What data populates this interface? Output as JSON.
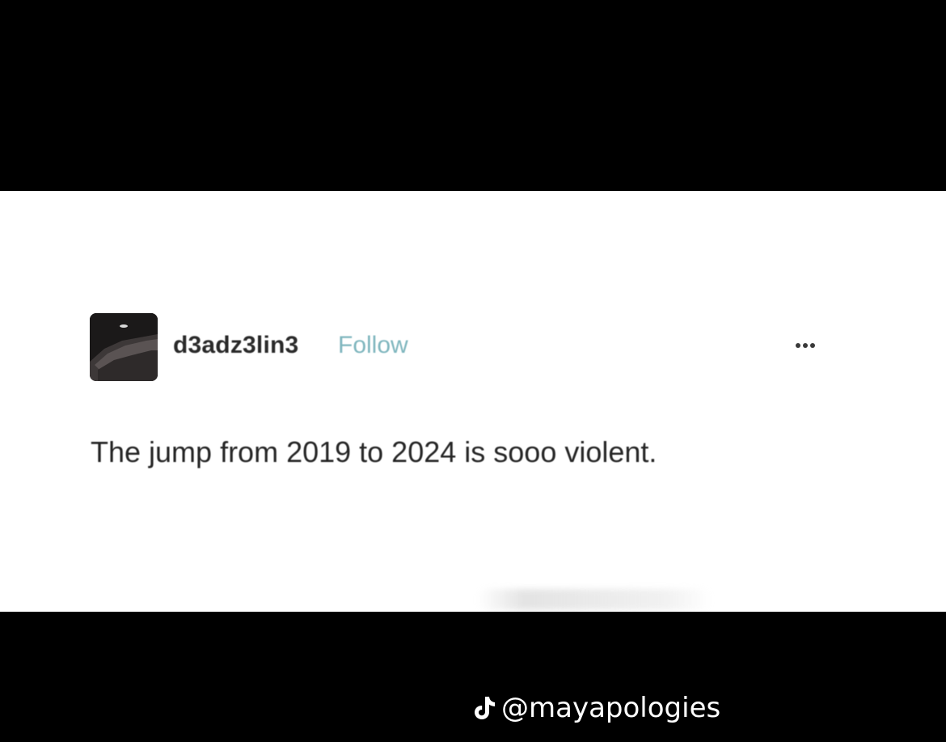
{
  "post": {
    "username": "d3adz3lin3",
    "follow_label": "Follow",
    "more_icon": "more-horizontal-icon",
    "text": "The jump from 2019 to 2024 is sooo violent."
  },
  "watermark": {
    "icon": "tiktok-icon",
    "handle": "@mayapologies"
  },
  "colors": {
    "background": "#000000",
    "card": "#ffffff",
    "follow": "#7fb6be",
    "text": "#262626"
  }
}
